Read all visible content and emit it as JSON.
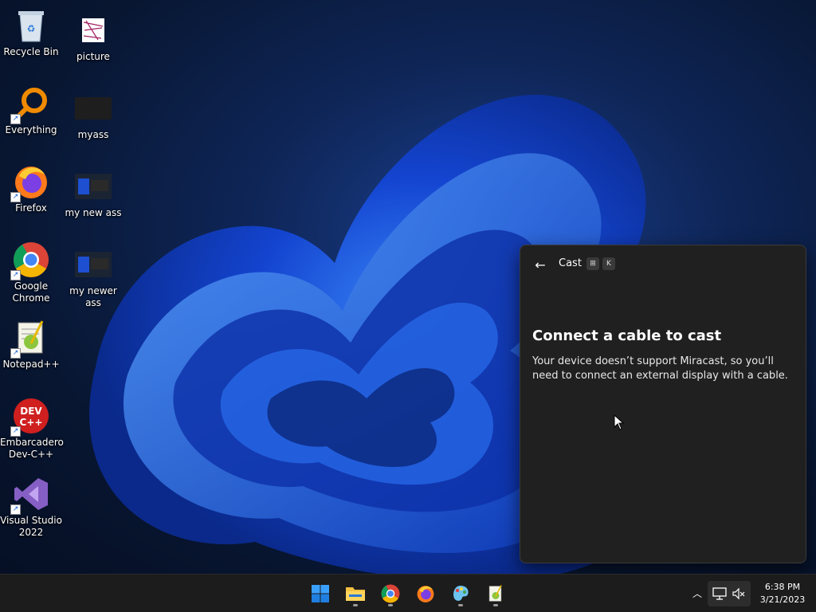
{
  "desktop": {
    "icons": [
      {
        "label": "Recycle Bin",
        "icon": "recycle-bin-icon"
      },
      {
        "label": "picture",
        "icon": "picture-file-icon"
      },
      {
        "label": "Everything",
        "icon": "everything-search-icon"
      },
      {
        "label": "myass",
        "icon": "image-file-icon"
      },
      {
        "label": "Firefox",
        "icon": "firefox-icon"
      },
      {
        "label": "my new ass",
        "icon": "image-file-icon"
      },
      {
        "label": "Google\nChrome",
        "icon": "chrome-icon"
      },
      {
        "label": "my newer ass",
        "icon": "image-file-icon"
      },
      {
        "label": "Notepad++",
        "icon": "notepad-plus-plus-icon"
      },
      {
        "label": "Embarcadero\nDev-C++",
        "icon": "dev-cpp-icon"
      },
      {
        "label": "Visual Studio\n2022",
        "icon": "visual-studio-icon"
      }
    ]
  },
  "cast_panel": {
    "title": "Cast",
    "shortcut_keys": [
      "⊞",
      "K"
    ],
    "heading": "Connect a cable to cast",
    "description": "Your device doesn’t support Miracast, so you’ll need to connect an external display with a cable."
  },
  "taskbar": {
    "apps": [
      {
        "name": "start",
        "icon": "windows-start-icon"
      },
      {
        "name": "file-explorer",
        "icon": "folder-icon"
      },
      {
        "name": "chrome",
        "icon": "chrome-icon"
      },
      {
        "name": "firefox",
        "icon": "firefox-icon"
      },
      {
        "name": "paint",
        "icon": "paint-icon"
      },
      {
        "name": "notepad-plus-plus",
        "icon": "notepad-plus-plus-icon"
      }
    ],
    "clock": {
      "time": "6:38 PM",
      "date": "3/21/2023"
    }
  },
  "colors": {
    "panel_bg": "#202020",
    "taskbar_bg": "#1c1c1c",
    "accent": "#0a5fd6"
  }
}
